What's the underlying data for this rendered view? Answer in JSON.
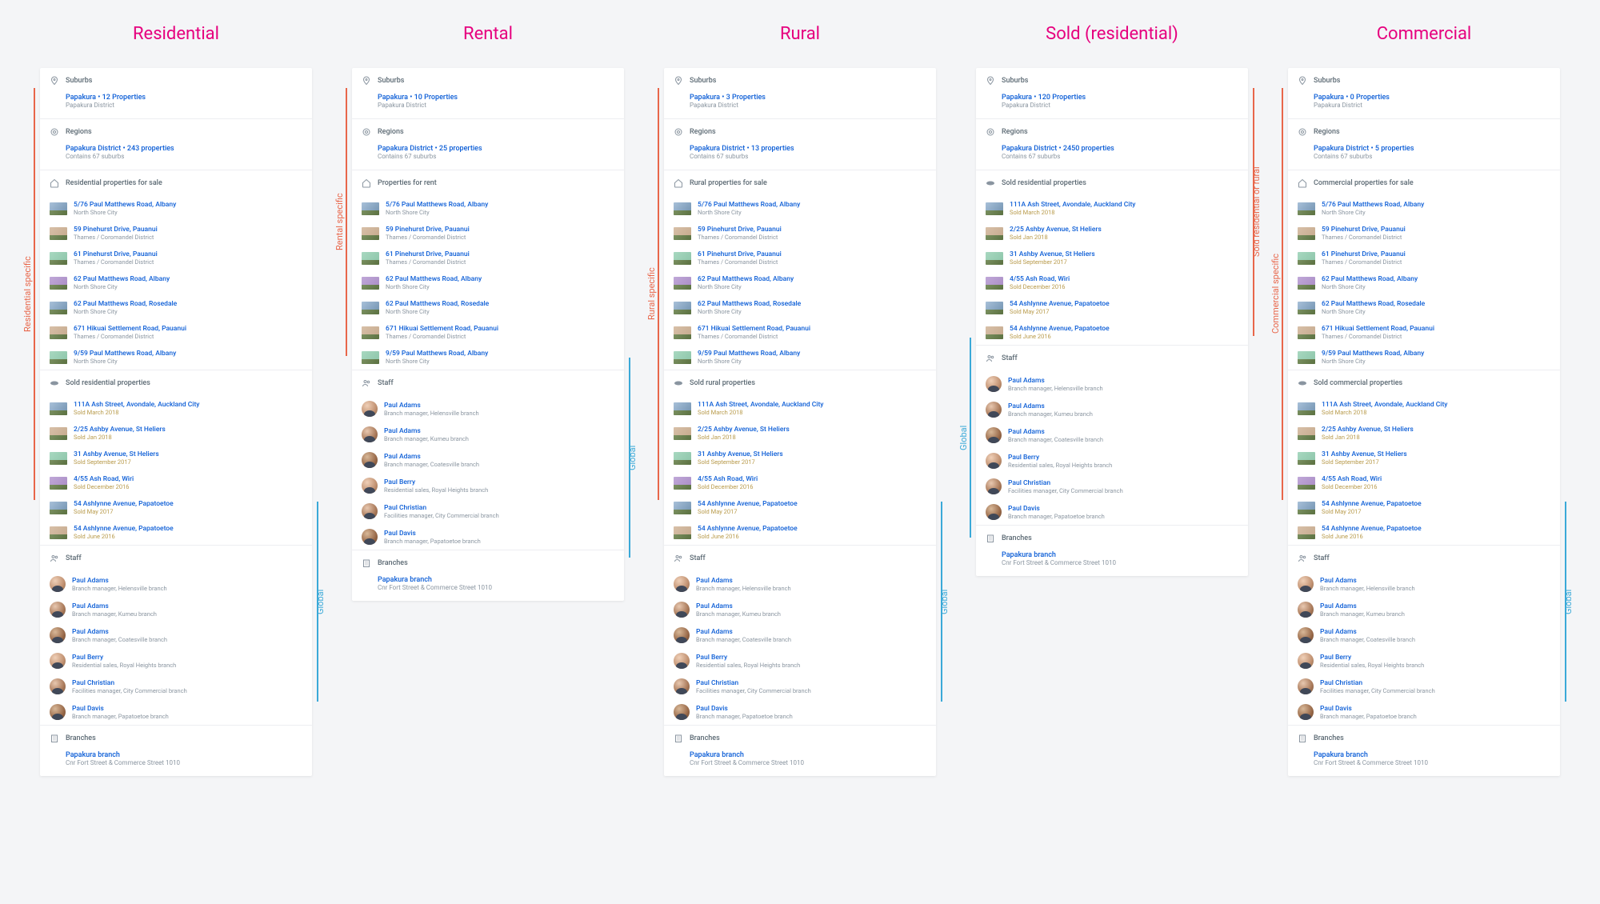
{
  "columns": [
    {
      "title": "Residential",
      "specific_label": "Residential specific",
      "global_label": "Global",
      "side": "left",
      "sections": [
        {
          "type": "suburbs",
          "header": "Suburbs",
          "primary": "Papakura • 12 Properties",
          "secondary": "Papakura District"
        },
        {
          "type": "regions",
          "header": "Regions",
          "primary": "Papakura District • 243 properties",
          "secondary": "Contains 67 suburbs"
        },
        {
          "type": "listings",
          "header": "Residential properties for sale",
          "items": [
            {
              "primary": "5/76 Paul Matthews Road, Albany",
              "secondary": "North Shore City"
            },
            {
              "primary": "59 Pinehurst Drive, Pauanui",
              "secondary": "Thames / Coromandel District"
            },
            {
              "primary": "61 Pinehurst Drive, Pauanui",
              "secondary": "Thames / Coromandel District"
            },
            {
              "primary": "62 Paul Matthews Road, Albany",
              "secondary": "North Shore City"
            },
            {
              "primary": "62 Paul Matthews Road, Rosedale",
              "secondary": "North Shore City"
            },
            {
              "primary": "671 Hikuai Settlement Road, Pauanui",
              "secondary": "Thames / Coromandel District"
            },
            {
              "primary": "9/59 Paul Matthews Road, Albany",
              "secondary": "North Shore City"
            }
          ]
        },
        {
          "type": "sold",
          "header": "Sold residential properties",
          "items": [
            {
              "primary": "111A Ash Street, Avondale, Auckland City",
              "secondary": "Sold March 2018"
            },
            {
              "primary": "2/25 Ashby Avenue, St Heliers",
              "secondary": "Sold Jan 2018"
            },
            {
              "primary": "31 Ashby Avenue, St Heliers",
              "secondary": "Sold September 2017"
            },
            {
              "primary": "4/55 Ash Road, Wiri",
              "secondary": "Sold December 2016"
            },
            {
              "primary": "54 Ashlynne Avenue, Papatoetoe",
              "secondary": "Sold May 2017"
            },
            {
              "primary": "54 Ashlynne Avenue, Papatoetoe",
              "secondary": "Sold June 2016"
            }
          ]
        },
        {
          "type": "staff",
          "header": "Staff",
          "items": [
            {
              "primary": "Paul Adams",
              "secondary": "Branch manager, Helensville branch"
            },
            {
              "primary": "Paul Adams",
              "secondary": "Branch manager, Kumeu branch"
            },
            {
              "primary": "Paul Adams",
              "secondary": "Branch manager, Coatesville branch"
            },
            {
              "primary": "Paul Berry",
              "secondary": "Residential sales, Royal Heights branch"
            },
            {
              "primary": "Paul Christian",
              "secondary": "Facilities manager, City Commercial branch"
            },
            {
              "primary": "Paul Davis",
              "secondary": "Branch manager, Papatoetoe branch"
            }
          ]
        },
        {
          "type": "branches",
          "header": "Branches",
          "primary": "Papakura branch",
          "secondary": "Cnr Fort Street & Commerce Street 1010"
        }
      ],
      "specific_end": 4,
      "specific_height": 515,
      "global_height": 250
    },
    {
      "title": "Rental",
      "specific_label": "Rental specific",
      "global_label": "Global",
      "side": "left",
      "sections": [
        {
          "type": "suburbs",
          "header": "Suburbs",
          "primary": "Papakura • 10 Properties",
          "secondary": "Papakura District"
        },
        {
          "type": "regions",
          "header": "Regions",
          "primary": "Papakura District • 25 properties",
          "secondary": "Contains 67 suburbs"
        },
        {
          "type": "listings",
          "header": "Properties for rent",
          "items": [
            {
              "primary": "5/76 Paul Matthews Road, Albany",
              "secondary": "North Shore City"
            },
            {
              "primary": "59 Pinehurst Drive, Pauanui",
              "secondary": "Thames / Coromandel District"
            },
            {
              "primary": "61 Pinehurst Drive, Pauanui",
              "secondary": "Thames / Coromandel District"
            },
            {
              "primary": "62 Paul Matthews Road, Albany",
              "secondary": "North Shore City"
            },
            {
              "primary": "62 Paul Matthews Road, Rosedale",
              "secondary": "North Shore City"
            },
            {
              "primary": "671 Hikuai Settlement Road, Pauanui",
              "secondary": "Thames / Coromandel District"
            },
            {
              "primary": "9/59 Paul Matthews Road, Albany",
              "secondary": "North Shore City"
            }
          ]
        },
        {
          "type": "staff",
          "header": "Staff",
          "items": [
            {
              "primary": "Paul Adams",
              "secondary": "Branch manager, Helensville branch"
            },
            {
              "primary": "Paul Adams",
              "secondary": "Branch manager, Kumeu branch"
            },
            {
              "primary": "Paul Adams",
              "secondary": "Branch manager, Coatesville branch"
            },
            {
              "primary": "Paul Berry",
              "secondary": "Residential sales, Royal Heights branch"
            },
            {
              "primary": "Paul Christian",
              "secondary": "Facilities manager, City Commercial branch"
            },
            {
              "primary": "Paul Davis",
              "secondary": "Branch manager, Papatoetoe branch"
            }
          ]
        },
        {
          "type": "branches",
          "header": "Branches",
          "primary": "Papakura branch",
          "secondary": "Cnr Fort Street & Commerce Street 1010"
        }
      ],
      "specific_end": 3,
      "specific_height": 335,
      "global_height": 250
    },
    {
      "title": "Rural",
      "specific_label": "Rural specific",
      "global_label": "Global",
      "side": "left",
      "sections": [
        {
          "type": "suburbs",
          "header": "Suburbs",
          "primary": "Papakura • 3 Properties",
          "secondary": "Papakura District"
        },
        {
          "type": "regions",
          "header": "Regions",
          "primary": "Papakura District • 13 properties",
          "secondary": "Contains 67 suburbs"
        },
        {
          "type": "listings",
          "header": "Rural properties for sale",
          "items": [
            {
              "primary": "5/76 Paul Matthews Road, Albany",
              "secondary": "North Shore City"
            },
            {
              "primary": "59 Pinehurst Drive, Pauanui",
              "secondary": "Thames / Coromandel District"
            },
            {
              "primary": "61 Pinehurst Drive, Pauanui",
              "secondary": "Thames / Coromandel District"
            },
            {
              "primary": "62 Paul Matthews Road, Albany",
              "secondary": "North Shore City"
            },
            {
              "primary": "62 Paul Matthews Road, Rosedale",
              "secondary": "North Shore City"
            },
            {
              "primary": "671 Hikuai Settlement Road, Pauanui",
              "secondary": "Thames / Coromandel District"
            },
            {
              "primary": "9/59 Paul Matthews Road, Albany",
              "secondary": "North Shore City"
            }
          ]
        },
        {
          "type": "sold",
          "header": "Sold rural properties",
          "items": [
            {
              "primary": "111A Ash Street, Avondale, Auckland City",
              "secondary": "Sold March 2018"
            },
            {
              "primary": "2/25 Ashby Avenue, St Heliers",
              "secondary": "Sold Jan 2018"
            },
            {
              "primary": "31 Ashby Avenue, St Heliers",
              "secondary": "Sold September 2017"
            },
            {
              "primary": "4/55 Ash Road, Wiri",
              "secondary": "Sold December 2016"
            },
            {
              "primary": "54 Ashlynne Avenue, Papatoetoe",
              "secondary": "Sold May 2017"
            },
            {
              "primary": "54 Ashlynne Avenue, Papatoetoe",
              "secondary": "Sold June 2016"
            }
          ]
        },
        {
          "type": "staff",
          "header": "Staff",
          "items": [
            {
              "primary": "Paul Adams",
              "secondary": "Branch manager, Helensville branch"
            },
            {
              "primary": "Paul Adams",
              "secondary": "Branch manager, Kumeu branch"
            },
            {
              "primary": "Paul Adams",
              "secondary": "Branch manager, Coatesville branch"
            },
            {
              "primary": "Paul Berry",
              "secondary": "Residential sales, Royal Heights branch"
            },
            {
              "primary": "Paul Christian",
              "secondary": "Facilities manager, City Commercial branch"
            },
            {
              "primary": "Paul Davis",
              "secondary": "Branch manager, Papatoetoe branch"
            }
          ]
        },
        {
          "type": "branches",
          "header": "Branches",
          "primary": "Papakura branch",
          "secondary": "Cnr Fort Street & Commerce Street 1010"
        }
      ],
      "specific_end": 4,
      "specific_height": 515,
      "global_height": 250
    },
    {
      "title": "Sold (residential)",
      "specific_label": "Sold residential or rural",
      "global_label": "Global",
      "side": "right",
      "sections": [
        {
          "type": "suburbs",
          "header": "Suburbs",
          "primary": "Papakura • 120 Properties",
          "secondary": "Papakura District"
        },
        {
          "type": "regions",
          "header": "Regions",
          "primary": "Papakura District • 2450 properties",
          "secondary": "Contains 67 suburbs"
        },
        {
          "type": "sold",
          "header": "Sold residential properties",
          "items": [
            {
              "primary": "111A Ash Street, Avondale, Auckland City",
              "secondary": "Sold March 2018"
            },
            {
              "primary": "2/25 Ashby Avenue, St Heliers",
              "secondary": "Sold Jan 2018"
            },
            {
              "primary": "31 Ashby Avenue, St Heliers",
              "secondary": "Sold September 2017"
            },
            {
              "primary": "4/55 Ash Road, Wiri",
              "secondary": "Sold December 2016"
            },
            {
              "primary": "54 Ashlynne Avenue, Papatoetoe",
              "secondary": "Sold May 2017"
            },
            {
              "primary": "54 Ashlynne Avenue, Papatoetoe",
              "secondary": "Sold June 2016"
            }
          ]
        },
        {
          "type": "staff",
          "header": "Staff",
          "items": [
            {
              "primary": "Paul Adams",
              "secondary": "Branch manager, Helensville branch"
            },
            {
              "primary": "Paul Adams",
              "secondary": "Branch manager, Kumeu branch"
            },
            {
              "primary": "Paul Adams",
              "secondary": "Branch manager, Coatesville branch"
            },
            {
              "primary": "Paul Berry",
              "secondary": "Residential sales, Royal Heights branch"
            },
            {
              "primary": "Paul Christian",
              "secondary": "Facilities manager, City Commercial branch"
            },
            {
              "primary": "Paul Davis",
              "secondary": "Branch manager, Papatoetoe branch"
            }
          ]
        },
        {
          "type": "branches",
          "header": "Branches",
          "primary": "Papakura branch",
          "secondary": "Cnr Fort Street & Commerce Street 1010"
        }
      ],
      "specific_end": 3,
      "specific_height": 310,
      "global_height": 250
    },
    {
      "title": "Commercial",
      "specific_label": "Commercial specific",
      "global_label": "Global",
      "side": "left",
      "global_side": "right",
      "sections": [
        {
          "type": "suburbs",
          "header": "Suburbs",
          "primary": "Papakura • 0 Properties",
          "secondary": "Papakura District"
        },
        {
          "type": "regions",
          "header": "Regions",
          "primary": "Papakura District • 5 properties",
          "secondary": "Contains 67 suburbs"
        },
        {
          "type": "listings",
          "header": "Commercial properties for sale",
          "items": [
            {
              "primary": "5/76 Paul Matthews Road, Albany",
              "secondary": "North Shore City"
            },
            {
              "primary": "59 Pinehurst Drive, Pauanui",
              "secondary": "Thames / Coromandel District"
            },
            {
              "primary": "61 Pinehurst Drive, Pauanui",
              "secondary": "Thames / Coromandel District"
            },
            {
              "primary": "62 Paul Matthews Road, Albany",
              "secondary": "North Shore City"
            },
            {
              "primary": "62 Paul Matthews Road, Rosedale",
              "secondary": "North Shore City"
            },
            {
              "primary": "671 Hikuai Settlement Road, Pauanui",
              "secondary": "Thames / Coromandel District"
            },
            {
              "primary": "9/59 Paul Matthews Road, Albany",
              "secondary": "North Shore City"
            }
          ]
        },
        {
          "type": "sold",
          "header": "Sold commercial properties",
          "items": [
            {
              "primary": "111A Ash Street, Avondale, Auckland City",
              "secondary": "Sold March 2018"
            },
            {
              "primary": "2/25 Ashby Avenue, St Heliers",
              "secondary": "Sold Jan 2018"
            },
            {
              "primary": "31 Ashby Avenue, St Heliers",
              "secondary": "Sold September 2017"
            },
            {
              "primary": "4/55 Ash Road, Wiri",
              "secondary": "Sold December 2016"
            },
            {
              "primary": "54 Ashlynne Avenue, Papatoetoe",
              "secondary": "Sold May 2017"
            },
            {
              "primary": "54 Ashlynne Avenue, Papatoetoe",
              "secondary": "Sold June 2016"
            }
          ]
        },
        {
          "type": "staff",
          "header": "Staff",
          "items": [
            {
              "primary": "Paul Adams",
              "secondary": "Branch manager, Helensville branch"
            },
            {
              "primary": "Paul Adams",
              "secondary": "Branch manager, Kumeu branch"
            },
            {
              "primary": "Paul Adams",
              "secondary": "Branch manager, Coatesville branch"
            },
            {
              "primary": "Paul Berry",
              "secondary": "Residential sales, Royal Heights branch"
            },
            {
              "primary": "Paul Christian",
              "secondary": "Facilities manager, City Commercial branch"
            },
            {
              "primary": "Paul Davis",
              "secondary": "Branch manager, Papatoetoe branch"
            }
          ]
        },
        {
          "type": "branches",
          "header": "Branches",
          "primary": "Papakura branch",
          "secondary": "Cnr Fort Street & Commerce Street 1010"
        }
      ],
      "specific_end": 4,
      "specific_height": 515,
      "global_height": 250
    }
  ],
  "icons": {
    "suburbs": "pin",
    "regions": "target",
    "listings": "home",
    "sold": "sold-badge",
    "staff": "people",
    "branches": "building"
  }
}
